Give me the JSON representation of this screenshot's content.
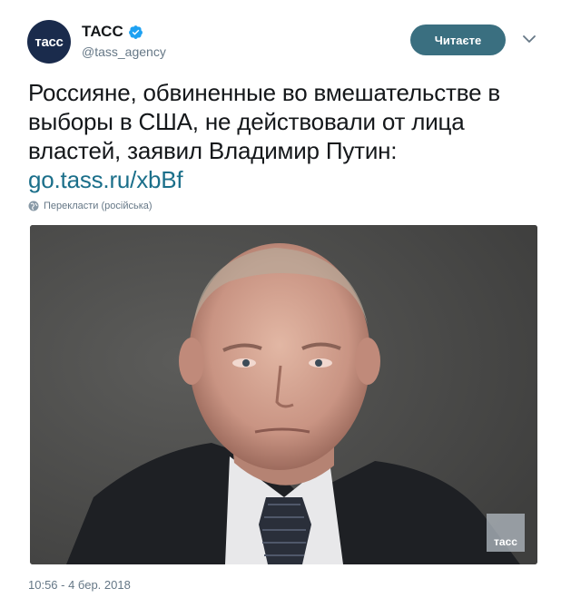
{
  "account": {
    "avatar_text": "тасс",
    "display_name": "ТАСС",
    "handle": "@tass_agency",
    "verified": true
  },
  "follow_button": {
    "label": "Читаєте"
  },
  "tweet": {
    "text": "Россияне, обвиненные во вмешательстве в выборы в США, не действовали от лица властей, заявил Владимир Путин:",
    "link": "go.tass.ru/xbBf",
    "translate_label": "Перекласти (російська)",
    "timestamp": "10:56 - 4 бер. 2018"
  },
  "media": {
    "watermark_text": "тасс"
  },
  "colors": {
    "follow_button": "#3a6f80",
    "link": "#1b6f8a",
    "verified_badge": "#1da1f2",
    "muted_text": "#657786"
  },
  "icons": {
    "verified": "verified-badge-icon",
    "caret": "chevron-down-icon",
    "globe": "globe-icon"
  }
}
